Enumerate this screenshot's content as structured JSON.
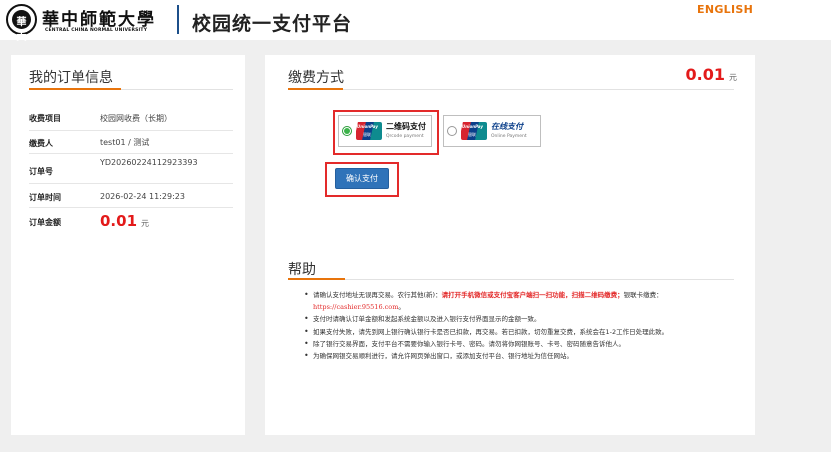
{
  "header": {
    "seal_text": "華大",
    "university_cn": "華中師範大學",
    "university_en": "CENTRAL CHINA NORMAL UNIVERSITY",
    "platform_title": "校园统一支付平台",
    "language_link": "ENGLISH"
  },
  "order": {
    "title": "我的订单信息",
    "rows": [
      {
        "label": "收费项目",
        "value": "校园网收费（长期）"
      },
      {
        "label": "缴费人",
        "value": "test01 / 测试"
      },
      {
        "label": "订单号",
        "value": "YD20260224112923393"
      },
      {
        "label": "订单时间",
        "value": "2026-02-24 11:29:23"
      },
      {
        "label": "订单金额",
        "value": "0.01",
        "unit": "元"
      }
    ]
  },
  "payment": {
    "title": "缴费方式",
    "amount": "0.01",
    "unit": "元",
    "methods": [
      {
        "logo_label": "UnionPay",
        "logo_sub": "银联",
        "name": "二维码支付",
        "sub": "Qrcode payment",
        "selected": true
      },
      {
        "logo_label": "UnionPay",
        "logo_sub": "银联",
        "name": "在线支付",
        "sub": "Online Payment",
        "selected": false
      }
    ],
    "confirm_label": "确认支付"
  },
  "help": {
    "title": "帮助",
    "items": [
      {
        "pre": "请确认支付地址无误再交易。农行其他(新)：",
        "red": "请打开手机微信或支付宝客户端扫一扫功能，扫描二维码缴费；",
        "post": "银联卡缴费：",
        "url": "https://cashier.95516.com",
        "end": "。"
      },
      {
        "text": "支付时请确认订单金额和发起系统金额以及进入银行支付界面显示的金额一致。"
      },
      {
        "text": "如果支付失败，请先到网上银行确认银行卡是否已扣款，再交易。若已扣款，切勿重复交费，系统会在1-2工作日处理此致。"
      },
      {
        "text": "除了银行交易界面，支付平台不需要你输入银行卡号、密码。请勿将你网银账号、卡号、密码随意告诉他人。"
      },
      {
        "text": "为确保网银交易顺利进行，请允许网页弹出窗口，或添加支付平台、银行地址为信任网站。"
      }
    ]
  },
  "colors": {
    "accent_orange": "#e8740c",
    "amount_red": "#e31a1a",
    "highlight_red": "#e32a2a",
    "button_blue": "#2f73b9",
    "page_bg": "#efefef"
  }
}
